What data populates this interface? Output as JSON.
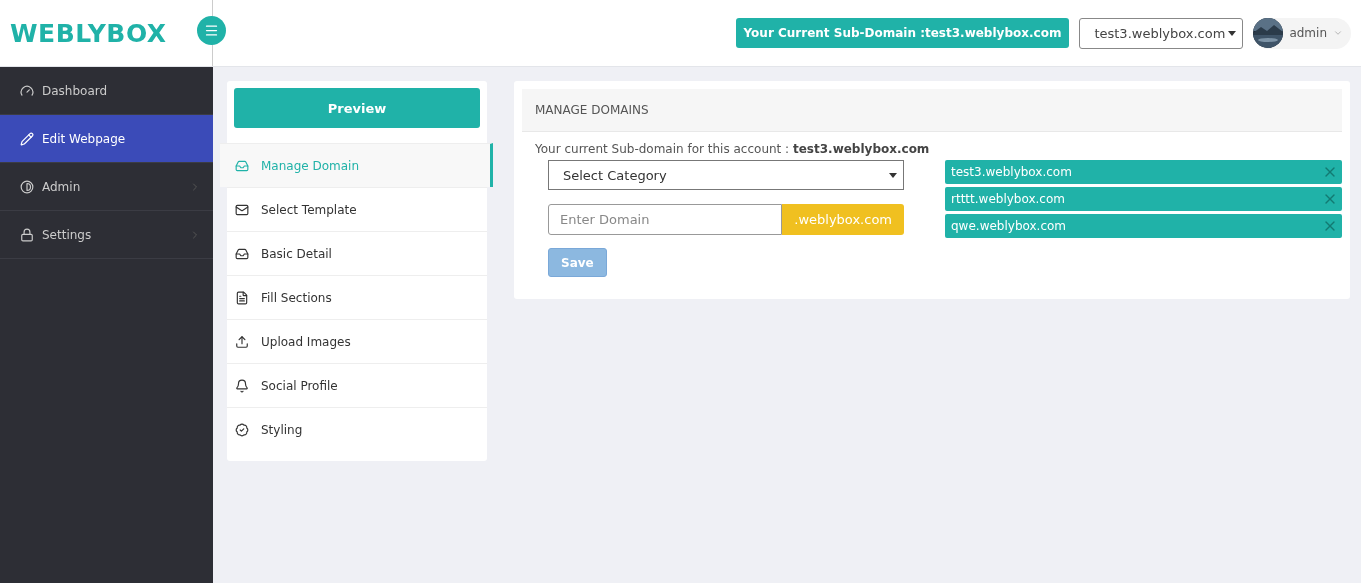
{
  "header": {
    "logo": "WEBLYBOX",
    "subdomain_badge": "Your Current Sub-Domain :test3.weblybox.com",
    "domain_select": "test3.weblybox.com",
    "user": "admin"
  },
  "sidebar": {
    "items": [
      {
        "label": "Dashboard",
        "selected": false,
        "has_children": false
      },
      {
        "label": "Edit Webpage",
        "selected": true,
        "has_children": false
      },
      {
        "label": "Admin",
        "selected": false,
        "has_children": true
      },
      {
        "label": "Settings",
        "selected": false,
        "has_children": true
      }
    ]
  },
  "steps": {
    "preview_button": "Preview",
    "items": [
      {
        "label": "Manage Domain",
        "selected": true
      },
      {
        "label": "Select Template",
        "selected": false
      },
      {
        "label": "Basic Detail",
        "selected": false
      },
      {
        "label": "Fill Sections",
        "selected": false
      },
      {
        "label": "Upload Images",
        "selected": false
      },
      {
        "label": "Social Profile",
        "selected": false
      },
      {
        "label": "Styling",
        "selected": false
      }
    ]
  },
  "panel": {
    "title": "MANAGE DOMAINS",
    "current_text": "Your current Sub-domain for this account : **test3.weblybox.com**",
    "category_select": "Select Category",
    "domain_field": {
      "placeholder": "Enter Domain",
      "suffix": ".weblybox.com"
    },
    "save_button": {
      "label": "Save",
      "disabled": true
    },
    "domains": [
      "test3.weblybox.com",
      "rtttt.weblybox.com",
      "qwe.weblybox.com"
    ]
  }
}
